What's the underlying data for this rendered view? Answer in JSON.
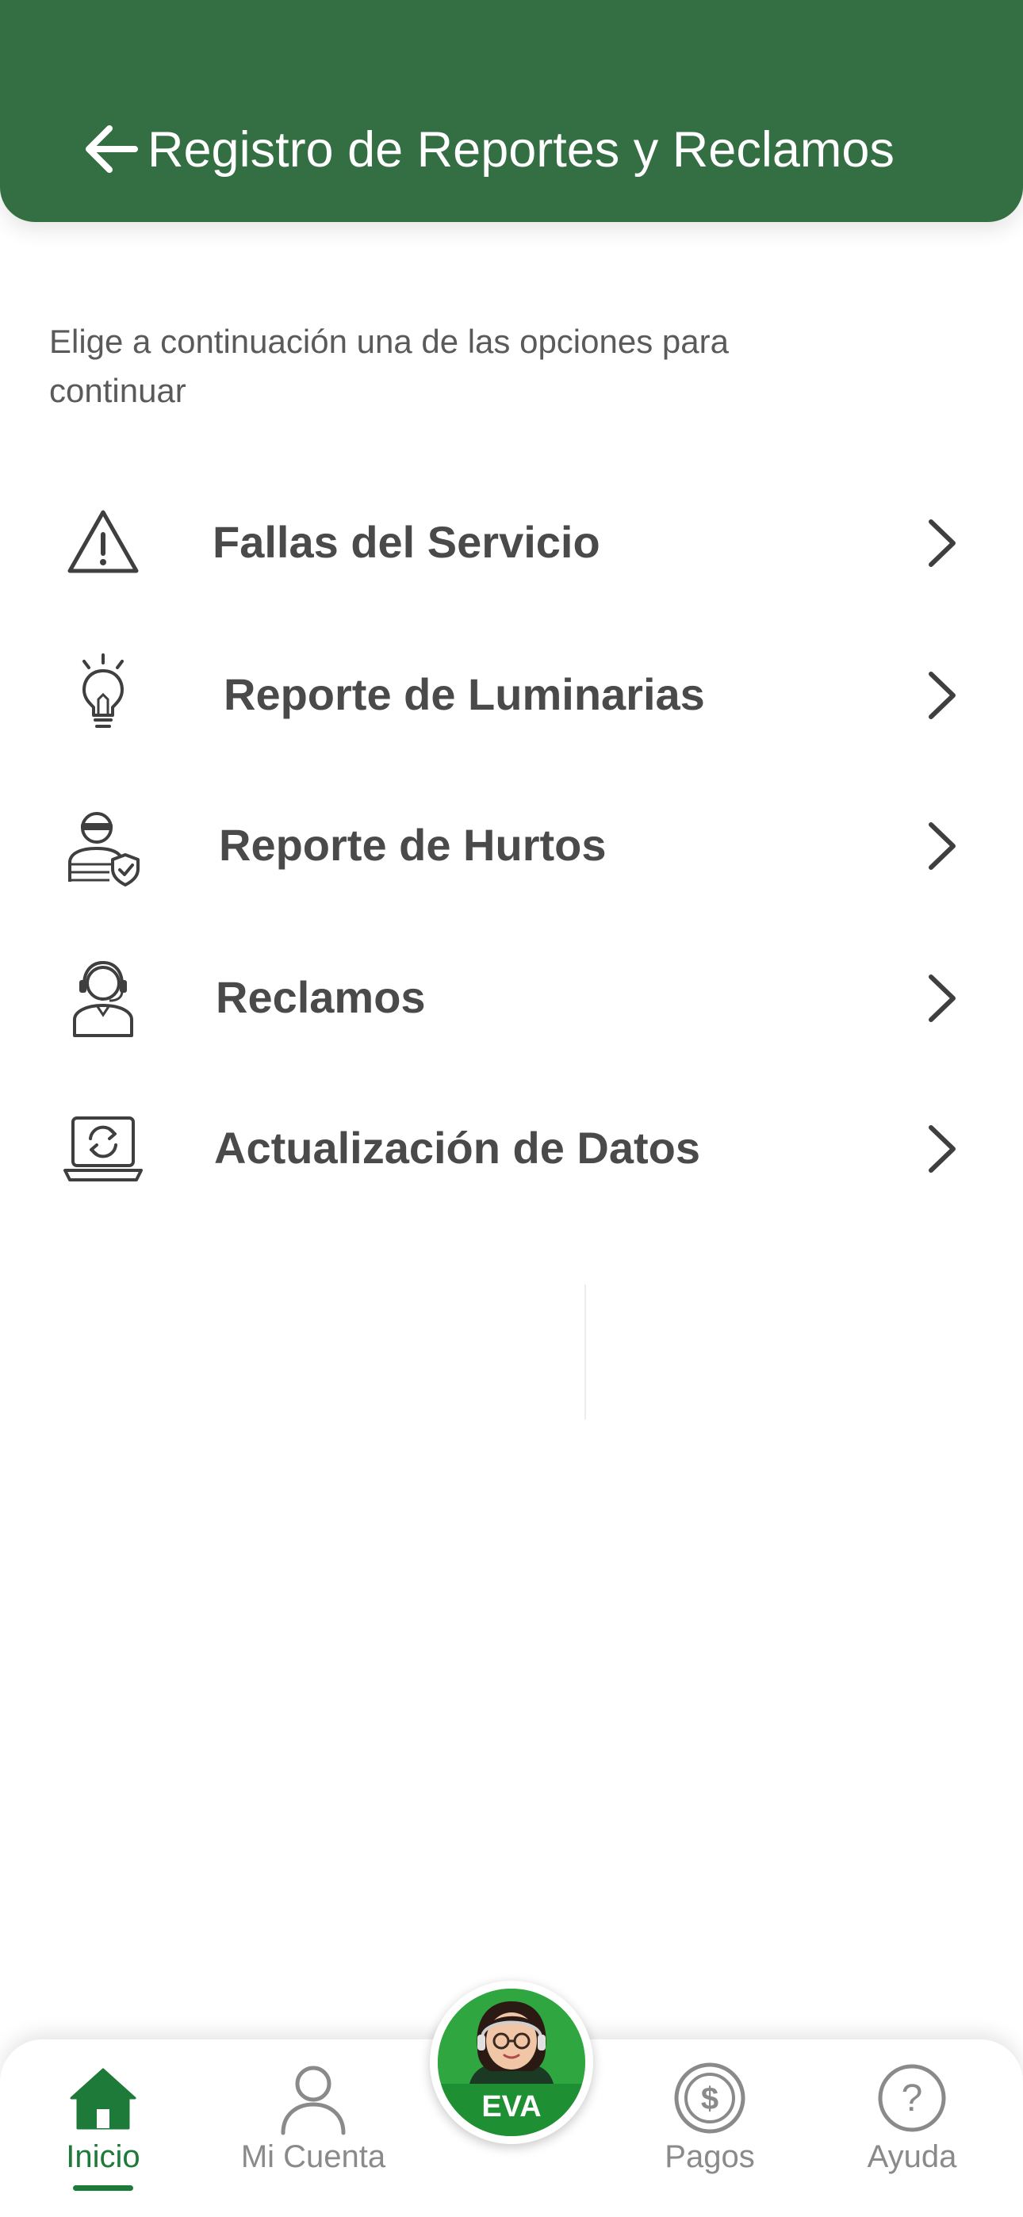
{
  "header": {
    "title": "Registro de Reportes y Reclamos",
    "background_color": "#336f42"
  },
  "intro_text": "Elige a continuación una de las opciones para continuar",
  "menu": [
    {
      "label": "Fallas del Servicio",
      "icon": "warning-triangle-icon"
    },
    {
      "label": "Reporte de Luminarias",
      "icon": "light-bulb-icon"
    },
    {
      "label": "Reporte de Hurtos",
      "icon": "thief-shield-icon"
    },
    {
      "label": "Reclamos",
      "icon": "support-agent-icon"
    },
    {
      "label": "Actualización de Datos",
      "icon": "laptop-refresh-icon"
    }
  ],
  "bottom_nav": {
    "items": [
      {
        "label": "Inicio",
        "icon": "home-icon",
        "active": true
      },
      {
        "label": "Mi Cuenta",
        "icon": "user-icon",
        "active": false
      },
      {
        "label": "Pagos",
        "icon": "dollar-coin-icon",
        "active": false
      },
      {
        "label": "Ayuda",
        "icon": "help-icon",
        "active": false
      }
    ],
    "assistant_label": "EVA",
    "active_color": "#1d7a38",
    "inactive_color": "#8a8a8a"
  }
}
